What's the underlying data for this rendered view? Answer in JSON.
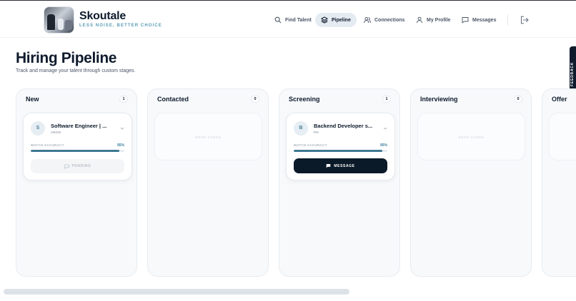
{
  "brand": {
    "name": "Skoutale",
    "tagline": "LESS NOISE, BETTER CHOICE"
  },
  "nav": {
    "items": [
      {
        "label": "Find Talent",
        "icon": "search-icon"
      },
      {
        "label": "Pipeline",
        "icon": "layers-icon",
        "active": true
      },
      {
        "label": "Connections",
        "icon": "users-icon"
      },
      {
        "label": "My Profile",
        "icon": "user-icon"
      },
      {
        "label": "Messages",
        "icon": "chat-icon"
      }
    ],
    "logout_icon": "logout-icon"
  },
  "page": {
    "title": "Hiring Pipeline",
    "subtitle": "Track and manage your talent through custom stages."
  },
  "feedback_label": "FEEDBACK",
  "columns": [
    {
      "title": "New",
      "count": "1",
      "card": {
        "initial": "S",
        "title": "Software Engineer | ...",
        "subtitle": "JHON",
        "match_label": "MATCH ACCURACY",
        "match_value": "95%",
        "match_fraction": 0.95,
        "action_label": "PENDING"
      }
    },
    {
      "title": "Contacted",
      "count": "0",
      "drop_label": "DROP CARDS"
    },
    {
      "title": "Screening",
      "count": "1",
      "card": {
        "initial": "B",
        "title": "Backend Developer s...",
        "subtitle": "PH",
        "match_label": "MATCH ACCURACY",
        "match_value": "95%",
        "match_fraction": 0.95,
        "action_label": "MESSAGE"
      }
    },
    {
      "title": "Interviewing",
      "count": "0",
      "drop_label": "DROP CARDS"
    },
    {
      "title": "Offer"
    }
  ],
  "colors": {
    "accent": "#3d7892",
    "dark": "#0b1a29",
    "active_nav": "#e4ebf1"
  }
}
